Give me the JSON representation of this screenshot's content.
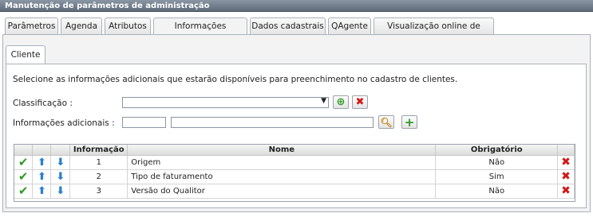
{
  "window": {
    "title": "Manutenção de parâmetros de administração"
  },
  "tabs": [
    {
      "label": "Parâmetros"
    },
    {
      "label": "Agenda"
    },
    {
      "label": "Atributos"
    },
    {
      "label": "Informações adicionais"
    },
    {
      "label": "Dados cadastrais"
    },
    {
      "label": "QAgente"
    },
    {
      "label": "Visualização online de anexos"
    }
  ],
  "subtab": {
    "label": "Cliente"
  },
  "description": "Selecione as informações adicionais que estarão disponíveis para preenchimento no cadastro de clientes.",
  "form": {
    "classificacao_label": "Classificação :",
    "classificacao_value": "",
    "info_label": "Informações adicionais :",
    "info_code": "",
    "info_name": ""
  },
  "grid": {
    "headers": {
      "informacao": "Informação",
      "nome": "Nome",
      "obrigatorio": "Obrigatório"
    },
    "rows": [
      {
        "informacao": "1",
        "nome": "Origem",
        "obrigatorio": "Não"
      },
      {
        "informacao": "2",
        "nome": "Tipo de faturamento",
        "obrigatorio": "Sim"
      },
      {
        "informacao": "3",
        "nome": "Versão do Qualitor",
        "obrigatorio": "Não"
      }
    ]
  },
  "icons": {
    "check": "check-icon",
    "up": "arrow-up-icon",
    "down": "arrow-down-icon",
    "delete": "delete-icon",
    "search": "search-icon",
    "add": "add-icon"
  },
  "colors": {
    "check": "#2f9a23",
    "arrow": "#2a7fd4",
    "delete": "#d21818",
    "titlebar": "#6b7685"
  }
}
